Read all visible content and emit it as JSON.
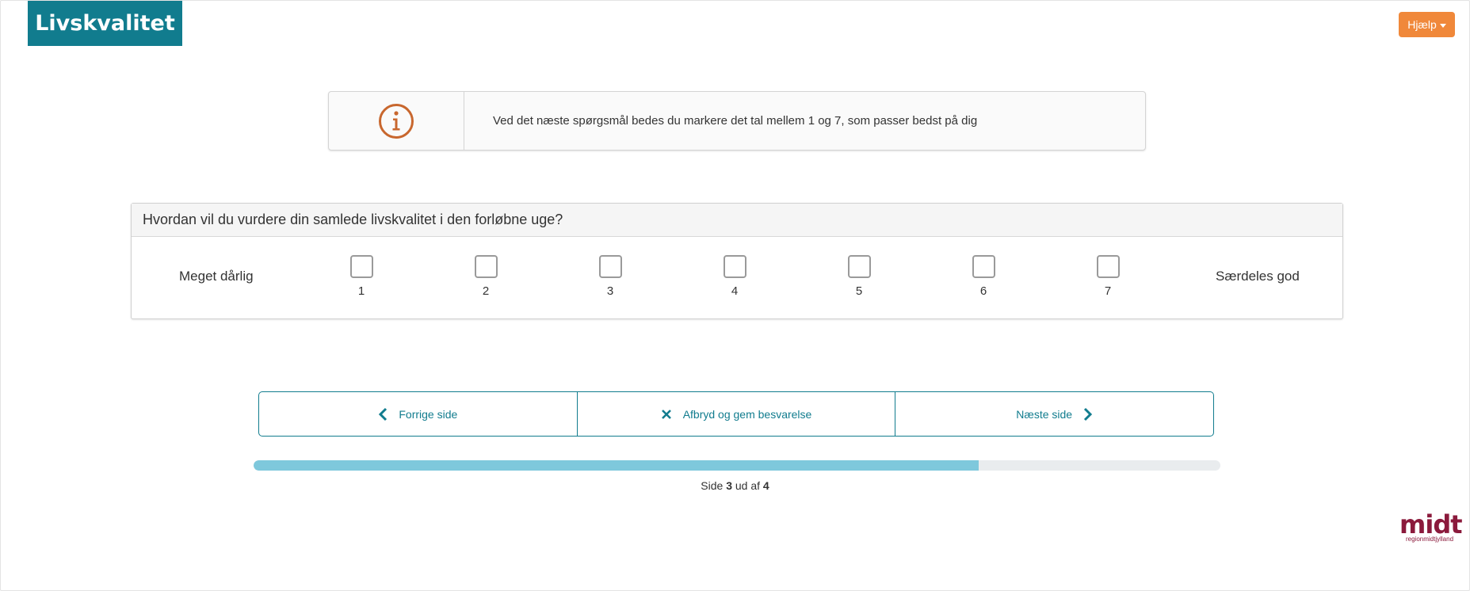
{
  "header": {
    "title": "Livskvalitet",
    "help_label": "Hjælp"
  },
  "info": {
    "icon": "info-circle-icon",
    "text": "Ved det næste spørgsmål bedes du markere det tal mellem 1 og 7, som passer bedst på dig"
  },
  "question": {
    "text": "Hvordan vil du vurdere din samlede livskvalitet i den forløbne uge?",
    "low_anchor": "Meget dårlig",
    "high_anchor": "Særdeles god",
    "options": [
      "1",
      "2",
      "3",
      "4",
      "5",
      "6",
      "7"
    ]
  },
  "nav": {
    "prev_label": "Forrige side",
    "cancel_label": "Afbryd og gem besvarelse",
    "next_label": "Næste side"
  },
  "progress": {
    "fraction": 0.75,
    "prefix": "Side",
    "current": "3",
    "middle": "ud af",
    "total": "4"
  },
  "logo": {
    "main": "midt",
    "sub": "regionmidtjylland"
  },
  "colors": {
    "brand": "#117c8e",
    "accent": "#f0883a",
    "progress": "#7ec8dc",
    "logo": "#8b1a3c"
  }
}
